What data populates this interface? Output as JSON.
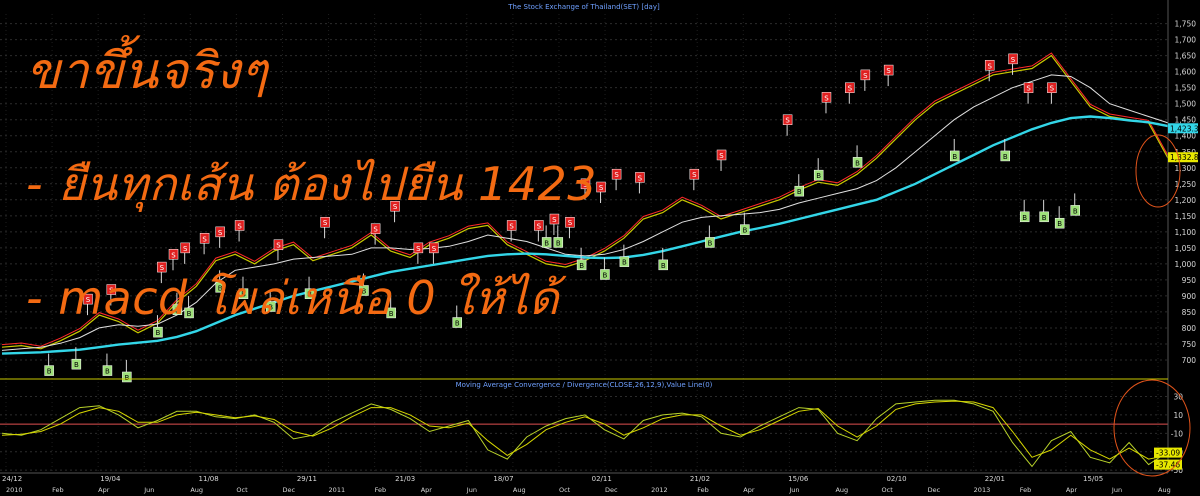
{
  "chart_data": [
    {
      "type": "line",
      "title": "The Stock Exchange of Thailand(SET) [day]",
      "ylim": [
        650,
        1780
      ],
      "y_ticks": [
        "700",
        "750",
        "800",
        "850",
        "900",
        "950",
        "1,000",
        "1,050",
        "1,100",
        "1,150",
        "1,200",
        "1,250",
        "1,300",
        "1,350",
        "1,400",
        "1,450",
        "1,500",
        "1,550",
        "1,600",
        "1,650",
        "1,700",
        "1,750"
      ],
      "x": [
        0,
        5,
        10,
        15,
        20,
        25,
        30,
        35,
        40,
        45,
        50,
        55,
        60,
        65,
        70,
        75,
        80,
        85,
        90,
        95,
        100,
        105,
        110,
        115,
        120,
        125,
        130,
        135,
        140,
        145,
        150,
        155,
        160,
        165,
        170,
        175,
        180,
        185,
        190,
        195,
        200,
        205,
        210,
        215,
        220,
        225,
        230,
        235,
        240,
        245,
        250,
        255,
        260,
        265,
        270,
        275,
        280,
        285,
        290,
        295,
        300
      ],
      "series": [
        {
          "values": [
            740,
            745,
            735,
            760,
            790,
            840,
            820,
            785,
            815,
            880,
            930,
            1010,
            1030,
            1000,
            1040,
            1060,
            1010,
            1030,
            1050,
            1090,
            1040,
            1020,
            1060,
            1080,
            1110,
            1120,
            1060,
            1030,
            1000,
            990,
            1010,
            1040,
            1080,
            1140,
            1160,
            1200,
            1175,
            1140,
            1160,
            1180,
            1200,
            1230,
            1255,
            1245,
            1280,
            1330,
            1390,
            1450,
            1500,
            1530,
            1560,
            1590,
            1600,
            1610,
            1650,
            1570,
            1490,
            1460,
            1450,
            1440,
            1330
          ]
        },
        {
          "values": [
            730,
            735,
            740,
            752,
            770,
            800,
            810,
            805,
            812,
            840,
            880,
            940,
            980,
            990,
            1000,
            1015,
            1020,
            1025,
            1030,
            1050,
            1050,
            1045,
            1048,
            1055,
            1070,
            1090,
            1080,
            1070,
            1050,
            1030,
            1025,
            1030,
            1045,
            1070,
            1100,
            1130,
            1145,
            1150,
            1155,
            1160,
            1170,
            1190,
            1205,
            1220,
            1235,
            1260,
            1300,
            1350,
            1400,
            1450,
            1490,
            1520,
            1550,
            1570,
            1590,
            1585,
            1550,
            1500,
            1480,
            1460,
            1440
          ]
        },
        {
          "values": [
            720,
            722,
            724,
            728,
            732,
            740,
            748,
            754,
            760,
            772,
            790,
            815,
            840,
            860,
            880,
            900,
            915,
            930,
            945,
            960,
            975,
            985,
            995,
            1005,
            1015,
            1025,
            1030,
            1032,
            1030,
            1025,
            1020,
            1018,
            1020,
            1028,
            1040,
            1055,
            1070,
            1085,
            1100,
            1112,
            1125,
            1140,
            1155,
            1170,
            1185,
            1200,
            1225,
            1250,
            1280,
            1310,
            1340,
            1370,
            1395,
            1420,
            1440,
            1455,
            1460,
            1455,
            1448,
            1442,
            1430
          ]
        }
      ],
      "price_labels": [
        "1,423.33",
        "1,332.86"
      ],
      "signals": {
        "sell": [
          [
            22,
            840
          ],
          [
            28,
            870
          ],
          [
            41,
            940
          ],
          [
            44,
            980
          ],
          [
            47,
            1000
          ],
          [
            52,
            1030
          ],
          [
            56,
            1050
          ],
          [
            61,
            1070
          ],
          [
            71,
            1010
          ],
          [
            83,
            1080
          ],
          [
            96,
            1060
          ],
          [
            101,
            1130
          ],
          [
            107,
            1000
          ],
          [
            111,
            1000
          ],
          [
            131,
            1070
          ],
          [
            138,
            1070
          ],
          [
            142,
            1090
          ],
          [
            146,
            1080
          ],
          [
            150,
            1200
          ],
          [
            154,
            1190
          ],
          [
            158,
            1230
          ],
          [
            164,
            1220
          ],
          [
            178,
            1230
          ],
          [
            185,
            1290
          ],
          [
            202,
            1400
          ],
          [
            212,
            1470
          ],
          [
            218,
            1500
          ],
          [
            222,
            1540
          ],
          [
            228,
            1555
          ],
          [
            254,
            1570
          ],
          [
            260,
            1590
          ],
          [
            264,
            1500
          ],
          [
            270,
            1500
          ]
        ],
        "buy": [
          [
            12,
            720
          ],
          [
            19,
            740
          ],
          [
            27,
            720
          ],
          [
            32,
            700
          ],
          [
            40,
            840
          ],
          [
            45,
            910
          ],
          [
            48,
            900
          ],
          [
            56,
            980
          ],
          [
            62,
            960
          ],
          [
            69,
            920
          ],
          [
            79,
            960
          ],
          [
            93,
            970
          ],
          [
            100,
            900
          ],
          [
            117,
            870
          ],
          [
            140,
            1120
          ],
          [
            143,
            1120
          ],
          [
            149,
            1050
          ],
          [
            155,
            1020
          ],
          [
            160,
            1060
          ],
          [
            170,
            1050
          ],
          [
            182,
            1120
          ],
          [
            191,
            1160
          ],
          [
            205,
            1280
          ],
          [
            210,
            1330
          ],
          [
            220,
            1370
          ],
          [
            245,
            1390
          ],
          [
            258,
            1390
          ],
          [
            263,
            1200
          ],
          [
            268,
            1200
          ],
          [
            272,
            1180
          ],
          [
            276,
            1220
          ]
        ]
      }
    },
    {
      "type": "line",
      "title": "Moving Average Convergence / Divergence(CLOSE,26,12,9),Value Line(0)",
      "ylim": [
        -52,
        36
      ],
      "y_ticks": [
        "30",
        "10",
        "-10",
        "-30",
        "-50"
      ],
      "x": [
        0,
        5,
        10,
        15,
        20,
        25,
        30,
        35,
        40,
        45,
        50,
        55,
        60,
        65,
        70,
        75,
        80,
        85,
        90,
        95,
        100,
        105,
        110,
        115,
        120,
        125,
        130,
        135,
        140,
        145,
        150,
        155,
        160,
        165,
        170,
        175,
        180,
        185,
        190,
        195,
        200,
        205,
        210,
        215,
        220,
        225,
        230,
        235,
        240,
        245,
        250,
        255,
        260,
        265,
        270,
        275,
        280,
        285,
        290,
        295,
        300
      ],
      "series": [
        {
          "values": [
            -10,
            -12,
            -6,
            6,
            18,
            20,
            10,
            -4,
            4,
            14,
            14,
            8,
            6,
            10,
            2,
            -16,
            -12,
            2,
            12,
            22,
            16,
            6,
            -8,
            -2,
            4,
            -28,
            -38,
            -14,
            -2,
            6,
            10,
            -6,
            -16,
            4,
            10,
            12,
            8,
            -10,
            -14,
            -2,
            8,
            18,
            16,
            -10,
            -18,
            6,
            22,
            24,
            26,
            26,
            22,
            14,
            -20,
            -46,
            -18,
            -8,
            -36,
            -42,
            -20,
            -44,
            -30
          ]
        },
        {
          "values": [
            -12,
            -11,
            -8,
            0,
            12,
            18,
            14,
            2,
            2,
            10,
            13,
            10,
            7,
            9,
            5,
            -8,
            -13,
            -4,
            8,
            18,
            18,
            10,
            -2,
            -4,
            1,
            -18,
            -34,
            -22,
            -6,
            2,
            8,
            0,
            -12,
            -4,
            6,
            10,
            10,
            -2,
            -12,
            -6,
            4,
            14,
            17,
            -2,
            -14,
            -2,
            16,
            22,
            24,
            25,
            24,
            18,
            -8,
            -36,
            -28,
            -12,
            -28,
            -38,
            -26,
            -38,
            -34
          ]
        }
      ],
      "value_line": 0,
      "value_labels": [
        "-33.09",
        "-37.46"
      ]
    }
  ],
  "date_ticks": [
    "24/12",
    "19/04",
    "11/08",
    "29/11",
    "21/03",
    "18/07",
    "02/11",
    "21/02",
    "15/06",
    "02/10",
    "22/01",
    "15/05"
  ],
  "month_ticks": [
    "2010",
    "Feb",
    "Apr",
    "Jun",
    "Aug",
    "Oct",
    "Dec",
    "2011",
    "Feb",
    "Apr",
    "Jun",
    "Aug",
    "Oct",
    "Dec",
    "2012",
    "Feb",
    "Apr",
    "Jun",
    "Aug",
    "Oct",
    "Dec",
    "2013",
    "Feb",
    "Apr",
    "Jun",
    "Aug"
  ],
  "signal_labels": {
    "sell": "S",
    "buy": "B"
  },
  "annotation": {
    "line1": "ขาขึ้นจริงๆ",
    "line2": "- ยืนทุกเส้น ต้องไปยืน 1423",
    "line3": "- macd โผล่เหนือ 0 ให้ได้"
  },
  "colors": {
    "price": "#c8c800",
    "price_fast": "#ff2a2a",
    "ma_slow": "#e0e0e0",
    "ma_long": "#33d6e8",
    "annotation": "#f36a12",
    "macd": "#b8d22a",
    "macd_signal": "#d6d600",
    "sell_box": "#e02020",
    "buy_box": "#9ee07a"
  }
}
